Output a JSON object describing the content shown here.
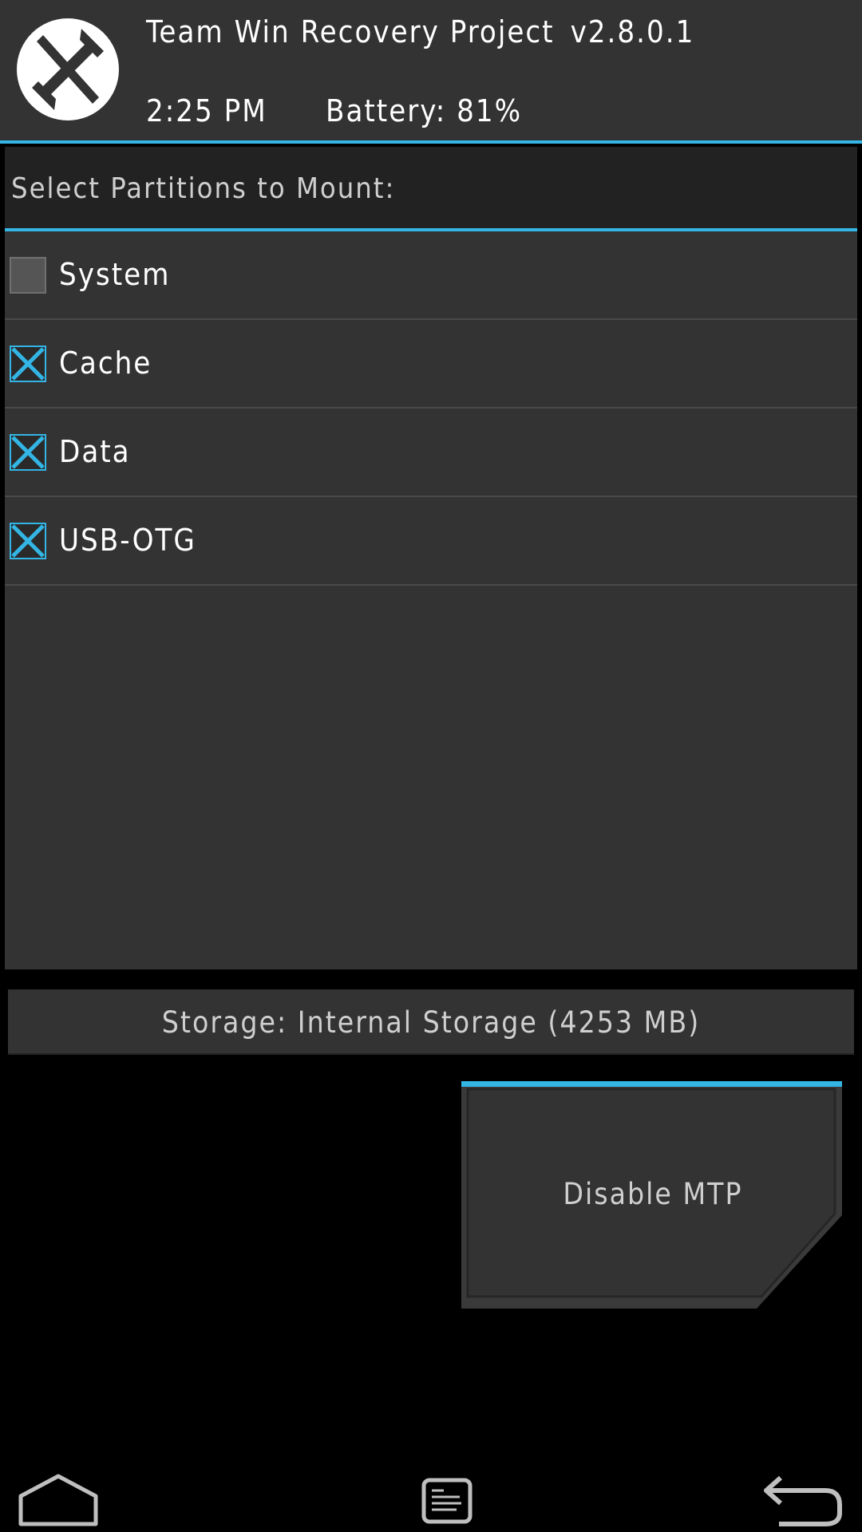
{
  "header": {
    "app_title": "Team Win Recovery Project",
    "version": "v2.8.0.1",
    "time": "2:25 PM",
    "battery": "Battery: 81%",
    "logo_icon": "twrp-logo-icon"
  },
  "mount": {
    "title": "Select Partitions to Mount:",
    "partitions": [
      {
        "label": "System",
        "checked": false
      },
      {
        "label": "Cache",
        "checked": true
      },
      {
        "label": "Data",
        "checked": true
      },
      {
        "label": "USB-OTG",
        "checked": true
      }
    ]
  },
  "storage": {
    "label": "Storage: Internal Storage (4253 MB)"
  },
  "mtp_button": {
    "label": "Disable MTP"
  },
  "navbar": {
    "icons": [
      "home-icon",
      "console-icon",
      "back-icon"
    ]
  },
  "colors": {
    "accent": "#33b5e5",
    "panel": "#333333",
    "title_bar": "#222222",
    "background": "#000000"
  }
}
